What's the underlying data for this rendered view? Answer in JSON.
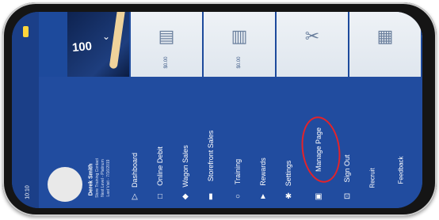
{
  "status": {
    "time": "10:10"
  },
  "cards": [
    {
      "name": "promo",
      "value": "100"
    },
    {
      "name": "card-2",
      "label": "$0.00"
    },
    {
      "name": "card-3",
      "label": "$0.00"
    },
    {
      "name": "card-4",
      "label": ""
    },
    {
      "name": "card-5",
      "label": ""
    }
  ],
  "profile": {
    "name": "Derek Smith",
    "meta": [
      "Store Training Contact",
      "Next Level - Platinum",
      "Last Visit - 7/16/2019"
    ]
  },
  "menu": {
    "items": [
      {
        "label": "Dashboard",
        "icon": "triangle-icon"
      },
      {
        "label": "Online Debit",
        "icon": "square-icon"
      },
      {
        "label": "Wagon Sales",
        "icon": "cart-icon"
      },
      {
        "label": "Storefront Sales",
        "icon": "store-icon"
      },
      {
        "label": "Training",
        "icon": "circle-icon"
      },
      {
        "label": "Rewards",
        "icon": "trophy-icon"
      },
      {
        "label": "Settings",
        "icon": "gear-icon"
      },
      {
        "label": "Manage Page",
        "icon": "page-icon"
      },
      {
        "label": "Sign Out",
        "icon": "signout-icon"
      },
      {
        "label": "Recruit",
        "icon": ""
      },
      {
        "label": "Feedback",
        "icon": ""
      }
    ],
    "highlighted": "Manage Page",
    "highlight_color": "#e3232a"
  },
  "colors": {
    "menu_bg": "#214c9f",
    "status_bg": "#1b3f88",
    "battery": "#ffd53b"
  }
}
